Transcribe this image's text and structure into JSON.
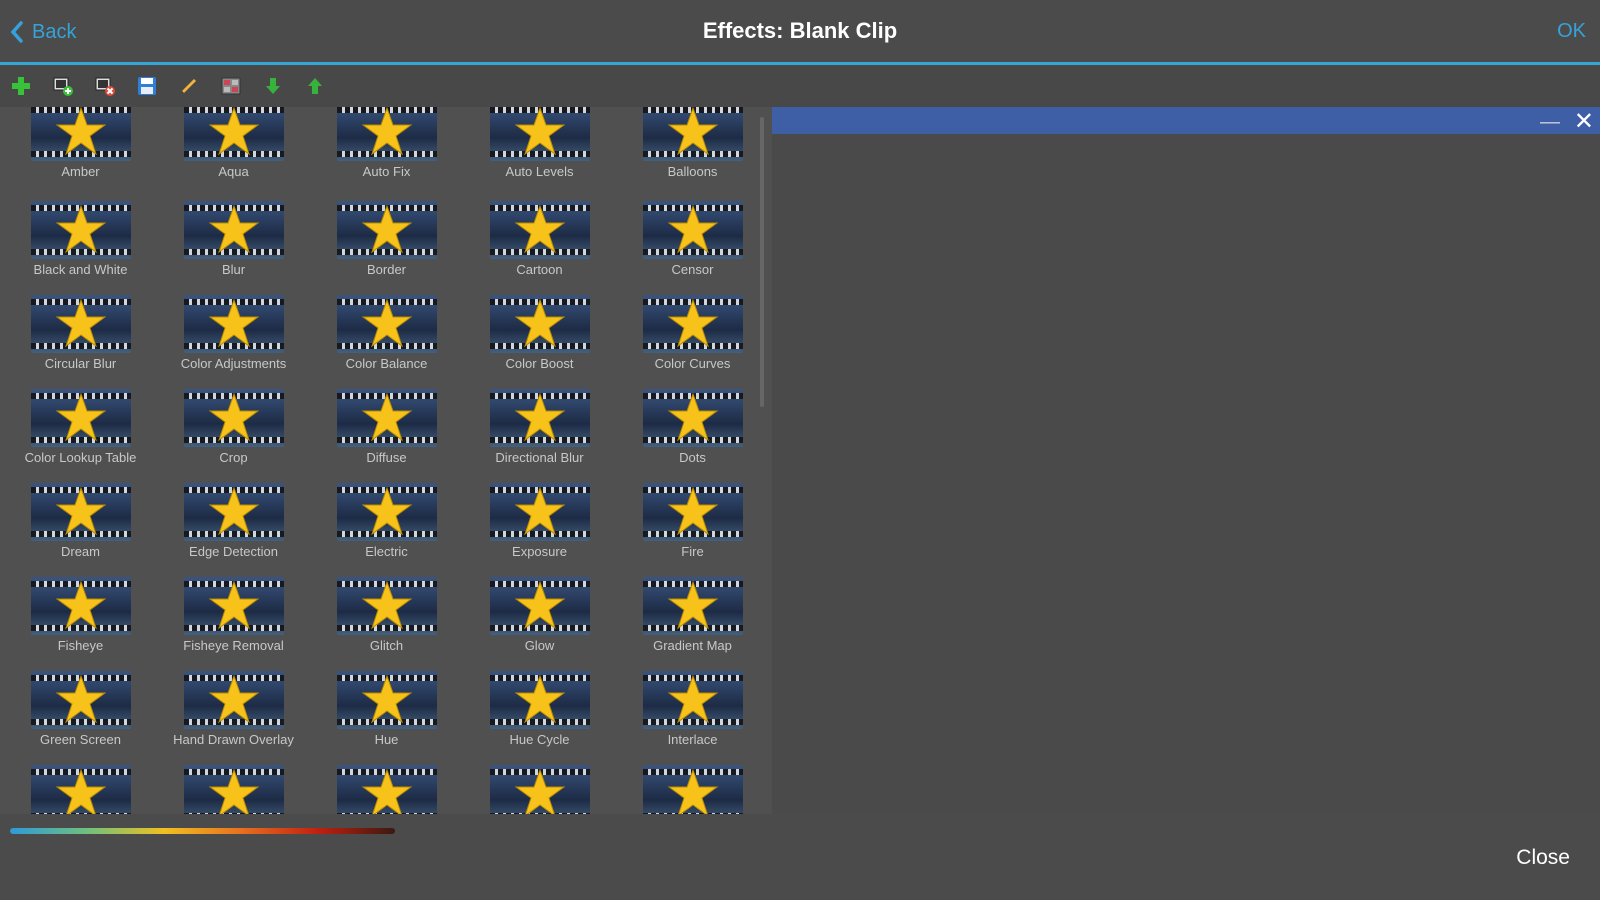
{
  "header": {
    "back_label": "Back",
    "title": "Effects: Blank Clip",
    "ok_label": "OK"
  },
  "toolbar": {
    "icons": [
      "add-icon",
      "add-to-timeline-icon",
      "remove-from-timeline-icon",
      "save-icon",
      "edit-icon",
      "grid-icon",
      "move-down-icon",
      "move-up-icon"
    ]
  },
  "effects": [
    "Amber",
    "Aqua",
    "Auto Fix",
    "Auto Levels",
    "Balloons",
    "Black and White",
    "Blur",
    "Border",
    "Cartoon",
    "Censor",
    "Circular Blur",
    "Color Adjustments",
    "Color Balance",
    "Color Boost",
    "Color Curves",
    "Color Lookup Table",
    "Crop",
    "Diffuse",
    "Directional Blur",
    "Dots",
    "Dream",
    "Edge Detection",
    "Electric",
    "Exposure",
    "Fire",
    "Fisheye",
    "Fisheye Removal",
    "Glitch",
    "Glow",
    "Gradient Map",
    "Green Screen",
    "Hand Drawn Overlay",
    "Hue",
    "Hue Cycle",
    "Interlace",
    "",
    "",
    "",
    "",
    ""
  ],
  "bottom": {
    "close_label": "Close"
  },
  "colors": {
    "accent": "#34a6d8",
    "panel_header": "#3e5fa6",
    "star": "#f7c21a"
  }
}
